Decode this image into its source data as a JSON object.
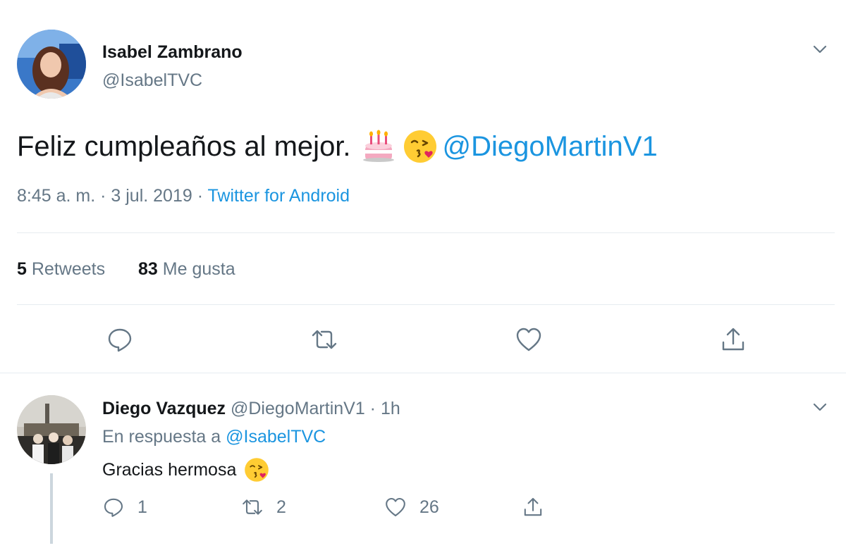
{
  "tweet": {
    "author_name": "Isabel Zambrano",
    "author_handle": "@IsabelTVC",
    "text": "Feliz cumpleaños al mejor.",
    "mention": "@DiegoMartinV1",
    "emojis": [
      "birthday-cake",
      "face-blowing-kiss"
    ],
    "time": "8:45 a. m. · 3 jul. 2019 · ",
    "source": "Twitter for Android",
    "retweets_count": "5",
    "retweets_label": "Retweets",
    "likes_count": "83",
    "likes_label": "Me gusta"
  },
  "reply": {
    "author_name": "Diego Vazquez",
    "author_handle_time": "@DiegoMartinV1 · 1h",
    "in_reply_prefix": "En respuesta a ",
    "in_reply_to": "@IsabelTVC",
    "text": "Gracias hermosa",
    "emoji": "face-blowing-kiss",
    "reply_count": "1",
    "retweet_count": "2",
    "like_count": "26"
  },
  "colors": {
    "accent": "#1b95e0",
    "secondary_text": "#657786",
    "primary_text": "#14171a",
    "divider": "#e6ecf0"
  }
}
